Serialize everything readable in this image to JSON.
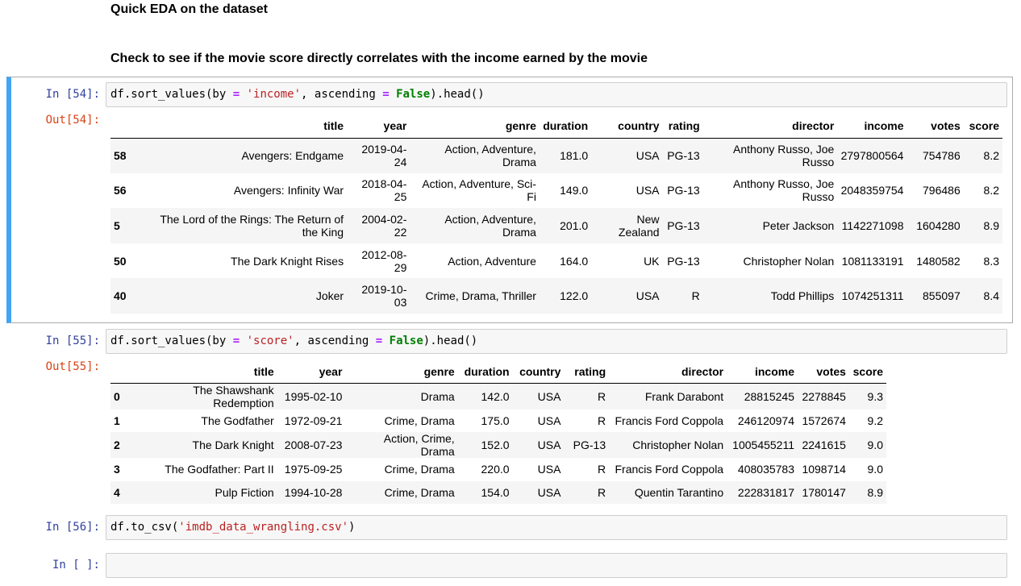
{
  "markdown": {
    "heading1": "Quick EDA on the dataset",
    "heading2": "Check to see if the movie score directly correlates with the income earned by the movie"
  },
  "cells": [
    {
      "in_prompt": "In [54]:",
      "out_prompt": "Out[54]:",
      "code": {
        "p1": "df.sort_values(by ",
        "op1": "=",
        "p2": " ",
        "str": "'income'",
        "p3": ", ascending ",
        "op2": "=",
        "p4": " ",
        "kw": "False",
        "p5": ").head()"
      }
    },
    {
      "in_prompt": "In [55]:",
      "out_prompt": "Out[55]:",
      "code": {
        "p1": "df.sort_values(by ",
        "op1": "=",
        "p2": " ",
        "str": "'score'",
        "p3": ", ascending ",
        "op2": "=",
        "p4": " ",
        "kw": "False",
        "p5": ").head()"
      }
    },
    {
      "in_prompt": "In [56]:",
      "code": {
        "p1": "df.to_csv(",
        "str": "'imdb_data_wrangling.csv'",
        "p2": ")"
      }
    },
    {
      "in_prompt": "In [ ]:"
    }
  ],
  "table1": {
    "columns": [
      "",
      "title",
      "year",
      "genre",
      "duration",
      "country",
      "rating",
      "director",
      "income",
      "votes",
      "score"
    ],
    "rows": [
      [
        "58",
        "Avengers: Endgame",
        "2019-04-24",
        "Action, Adventure, Drama",
        "181.0",
        "USA",
        "PG-13",
        "Anthony Russo, Joe Russo",
        "2797800564",
        "754786",
        "8.2"
      ],
      [
        "56",
        "Avengers: Infinity War",
        "2018-04-25",
        "Action, Adventure, Sci-Fi",
        "149.0",
        "USA",
        "PG-13",
        "Anthony Russo, Joe Russo",
        "2048359754",
        "796486",
        "8.2"
      ],
      [
        "5",
        "The Lord of the Rings: The Return of the King",
        "2004-02-22",
        "Action, Adventure, Drama",
        "201.0",
        "New Zealand",
        "PG-13",
        "Peter Jackson",
        "1142271098",
        "1604280",
        "8.9"
      ],
      [
        "50",
        "The Dark Knight Rises",
        "2012-08-29",
        "Action, Adventure",
        "164.0",
        "UK",
        "PG-13",
        "Christopher Nolan",
        "1081133191",
        "1480582",
        "8.3"
      ],
      [
        "40",
        "Joker",
        "2019-10-03",
        "Crime, Drama, Thriller",
        "122.0",
        "USA",
        "R",
        "Todd Phillips",
        "1074251311",
        "855097",
        "8.4"
      ]
    ]
  },
  "table2": {
    "columns": [
      "",
      "title",
      "year",
      "genre",
      "duration",
      "country",
      "rating",
      "director",
      "income",
      "votes",
      "score"
    ],
    "rows": [
      [
        "0",
        "The Shawshank Redemption",
        "1995-02-10",
        "Drama",
        "142.0",
        "USA",
        "R",
        "Frank Darabont",
        "28815245",
        "2278845",
        "9.3"
      ],
      [
        "1",
        "The Godfather",
        "1972-09-21",
        "Crime, Drama",
        "175.0",
        "USA",
        "R",
        "Francis Ford Coppola",
        "246120974",
        "1572674",
        "9.2"
      ],
      [
        "2",
        "The Dark Knight",
        "2008-07-23",
        "Action, Crime, Drama",
        "152.0",
        "USA",
        "PG-13",
        "Christopher Nolan",
        "1005455211",
        "2241615",
        "9.0"
      ],
      [
        "3",
        "The Godfather: Part II",
        "1975-09-25",
        "Crime, Drama",
        "220.0",
        "USA",
        "R",
        "Francis Ford Coppola",
        "408035783",
        "1098714",
        "9.0"
      ],
      [
        "4",
        "Pulp Fiction",
        "1994-10-28",
        "Crime, Drama",
        "154.0",
        "USA",
        "R",
        "Quentin Tarantino",
        "222831817",
        "1780147",
        "8.9"
      ]
    ]
  }
}
